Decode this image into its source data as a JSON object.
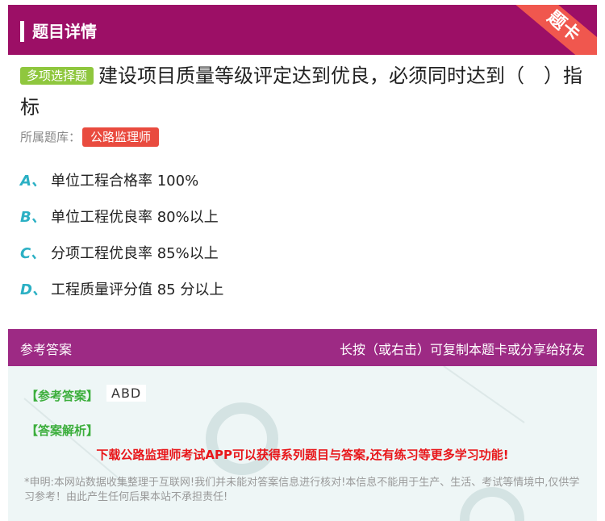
{
  "header": {
    "title": "题目详情",
    "ribbon": "题卡"
  },
  "question": {
    "type_badge": "多项选择题",
    "text_line1": "建设项目质量等级评定达到优良，必须同时达到（　）指",
    "text_line2": "标",
    "bank_label": "所属题库：",
    "bank_name": "公路监理师"
  },
  "options": [
    {
      "letter": "A、",
      "text": "单位工程合格率 100%"
    },
    {
      "letter": "B、",
      "text": "单位工程优良率 80%以上"
    },
    {
      "letter": "C、",
      "text": "分项工程优良率 85%以上"
    },
    {
      "letter": "D、",
      "text": "工程质量评分值 85 分以上"
    }
  ],
  "answer_bar": {
    "left": "参考答案",
    "right": "长按（或右击）可复制本题卡或分享给好友"
  },
  "answer_panel": {
    "ref_label": "【参考答案】",
    "ref_value": "ABD",
    "analysis_label": "【答案解析】",
    "promo": "下载公路监理师考试APP可以获得系列题目与答案,还有练习等更多学习功能!",
    "disclaimer": "*申明:本网站数据收集整理于互联网!我们并未能对答案信息进行核对!本信息不能用于生产、生活、考试等情境中,仅供学习参考！由此产生任何后果本站不承担责任!"
  },
  "colors": {
    "header": "#9c0f66",
    "ribbon": "#f0574e",
    "type_badge": "#8fc73e",
    "bank_badge": "#e94b3f",
    "option_letter": "#2bb0c4",
    "answer_bar": "#9d2a84",
    "answer_label": "#3cae3c",
    "promo": "#e8161a"
  }
}
